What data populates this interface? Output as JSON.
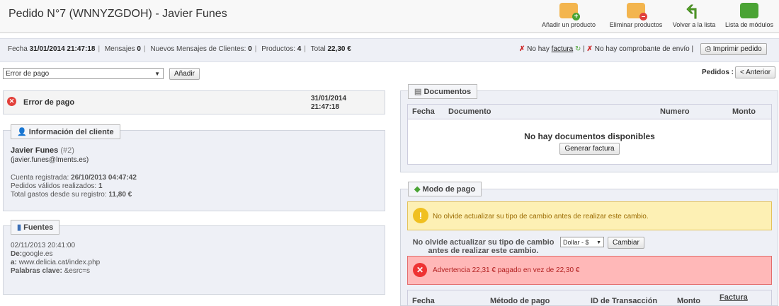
{
  "header": {
    "title": "Pedido N°7 (WNNYZGDOH) - Javier Funes",
    "toolbar": [
      {
        "label": "Añadir un producto",
        "icon": "folder-add-icon"
      },
      {
        "label": "Eliminar productos",
        "icon": "folder-remove-icon"
      },
      {
        "label": "Volver a la lista",
        "icon": "back-arrow-icon"
      },
      {
        "label": "Lista de módulos",
        "icon": "puzzle-icon"
      }
    ]
  },
  "summary": {
    "fecha_label": "Fecha",
    "fecha_value": "31/01/2014 21:47:18",
    "mensajes_label": "Mensajes",
    "mensajes_value": "0",
    "nuevos_label": "Nuevos Mensajes de Clientes:",
    "nuevos_value": "0",
    "productos_label": "Productos:",
    "productos_value": "4",
    "total_label": "Total",
    "total_value": "22,30 €",
    "no_hay": "No hay",
    "factura_link": "factura",
    "no_comprobante": "No hay comprobante de envío",
    "print_button": "Imprimir pedido"
  },
  "status_form": {
    "selected": "Error de pago",
    "add_button": "Añadir"
  },
  "orders_nav": {
    "label": "Pedidos",
    "prev_button": "< Anterior"
  },
  "status_history": {
    "status": "Error de pago",
    "date": "31/01/2014",
    "time": "21:47:18"
  },
  "customer": {
    "legend": "Información del cliente",
    "name": "Javier Funes",
    "id": "(#2)",
    "email": "(javier.funes@lments.es)",
    "registered_label": "Cuenta registrada:",
    "registered_value": "26/10/2013 04:47:42",
    "orders_label": "Pedidos válidos realizados:",
    "orders_value": "1",
    "spent_label": "Total gastos desde su registro:",
    "spent_value": "11,80 €"
  },
  "sources": {
    "legend": "Fuentes",
    "datetime": "02/11/2013 20:41:00",
    "from_label": "De:",
    "from_value": "google.es",
    "to_label": "a:",
    "to_value": "www.delicia.cat/index.php",
    "keywords_label": "Palabras clave:",
    "keywords_value": "&esrc=s"
  },
  "documents": {
    "legend": "Documentos",
    "columns": [
      "Fecha",
      "Documento",
      "Numero",
      "Monto"
    ],
    "empty_text": "No hay documentos disponibles",
    "generate_button": "Generar factura"
  },
  "payment": {
    "legend": "Modo de pago",
    "warning": "No olvide actualizar su tipo de cambio antes de realizar este cambio.",
    "change_label_1": "No olvide actualizar su tipo de cambio",
    "change_label_2": "antes de realizar este cambio.",
    "currency": "Dollar - $",
    "change_button": "Cambiar",
    "error": "Advertencia 22,31 € pagado en vez de 22,30 €",
    "columns": [
      "Fecha",
      "Método de pago",
      "ID de Transacción",
      "Monto",
      "Factura"
    ]
  }
}
